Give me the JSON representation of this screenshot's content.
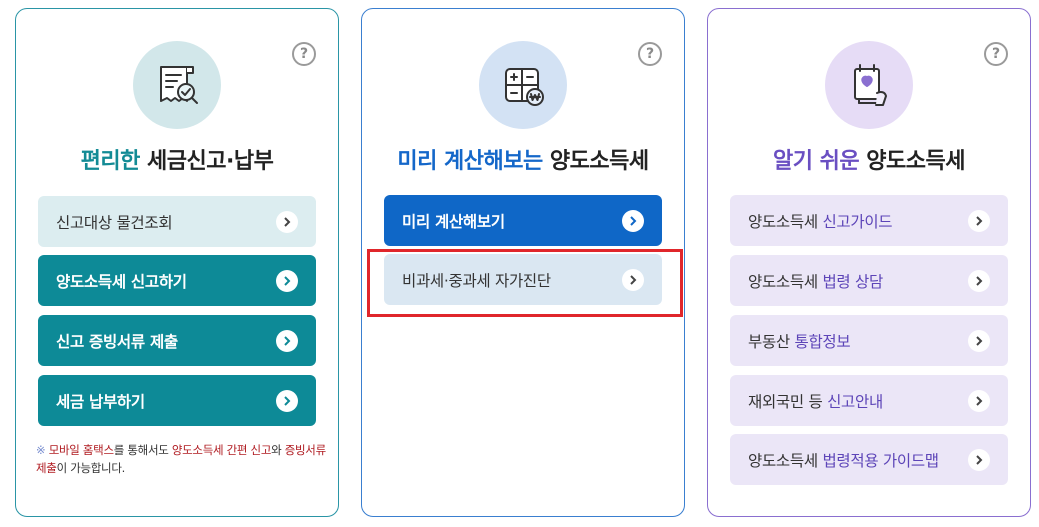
{
  "cards": [
    {
      "help_label": "?",
      "emblem_icon": "receipt-search-icon",
      "title_highlight": "편리한",
      "title_rest": "세금신고·납부",
      "buttons": [
        {
          "label": "신고대상 물건조회"
        },
        {
          "label": "양도소득세 신고하기"
        },
        {
          "label": "신고 증빙서류 제출"
        },
        {
          "label": "세금 납부하기"
        }
      ],
      "note": {
        "mark": "※",
        "p1": "모바일 홈택스",
        "p2": "를 통해서도 ",
        "p3": "양도소득세 간편 신고",
        "p4": "와 ",
        "p5": "증빙서류 제출",
        "p6": "이 가능합니다."
      }
    },
    {
      "help_label": "?",
      "emblem_icon": "calculator-icon",
      "title_highlight": "미리 계산해보는",
      "title_rest": "양도소득세",
      "buttons": [
        {
          "label": "미리 계산해보기"
        },
        {
          "label": "비과세·중과세 자가진단"
        }
      ]
    },
    {
      "help_label": "?",
      "emblem_icon": "heart-book-icon",
      "title_highlight": "알기 쉬운",
      "title_rest": "양도소득세",
      "buttons": [
        {
          "prefix": "양도소득세 ",
          "accent": "신고가이드"
        },
        {
          "prefix": "양도소득세 ",
          "accent": "법령 상담"
        },
        {
          "prefix": "부동산 ",
          "accent": "통합정보"
        },
        {
          "prefix": "재외국민 등 ",
          "accent": "신고안내"
        },
        {
          "prefix": "양도소득세 ",
          "accent": "법령적용 가이드맵"
        }
      ]
    }
  ],
  "colors": {
    "teal": "#0d8a97",
    "blue": "#0f67c7",
    "purple": "#6a4fc2",
    "highlight_red": "#e0262b"
  }
}
